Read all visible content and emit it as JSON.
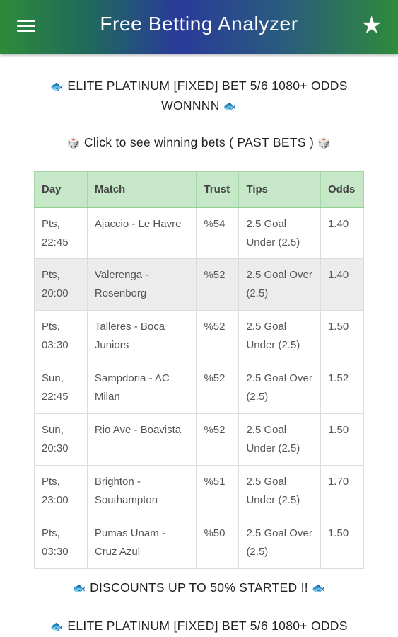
{
  "appbar": {
    "title": "Free Betting Analyzer",
    "menu_icon": "hamburger-menu-icon",
    "star_icon": "star-icon",
    "star_glyph": "★"
  },
  "promos": {
    "elite_top": "ELITE PLATINUM [FIXED] BET 5/6 1080+ ODDS WONNNN",
    "winning_bets": "Click to see winning bets ( PAST BETS )",
    "discounts": "DISCOUNTS UP TO 50% STARTED !!",
    "elite_bottom": "ELITE PLATINUM [FIXED] BET 5/6 1080+ ODDS",
    "fish_glyph": "🐟",
    "dice_glyph": "🎲"
  },
  "table": {
    "headers": {
      "day": "Day",
      "match": "Match",
      "trust": "Trust",
      "tips": "Tips",
      "odds": "Odds"
    },
    "rows": [
      {
        "day": "Pts, 22:45",
        "match": "Ajaccio - Le Havre",
        "trust": "%54",
        "tips": "2.5 Goal Under (2.5)",
        "odds": "1.40"
      },
      {
        "day": "Pts, 20:00",
        "match": "Valerenga - Rosenborg",
        "trust": "%52",
        "tips": "2.5 Goal Over (2.5)",
        "odds": "1.40"
      },
      {
        "day": "Pts, 03:30",
        "match": "Talleres - Boca Juniors",
        "trust": "%52",
        "tips": "2.5 Goal Under (2.5)",
        "odds": "1.50"
      },
      {
        "day": "Sun, 22:45",
        "match": "Sampdoria - AC Milan",
        "trust": "%52",
        "tips": "2.5 Goal Over (2.5)",
        "odds": "1.52"
      },
      {
        "day": "Sun, 20:30",
        "match": "Rio Ave - Boavista",
        "trust": "%52",
        "tips": "2.5 Goal Under (2.5)",
        "odds": "1.50"
      },
      {
        "day": "Pts, 23:00",
        "match": "Brighton - Southampton",
        "trust": "%51",
        "tips": "2.5 Goal Under (2.5)",
        "odds": "1.70"
      },
      {
        "day": "Pts, 03:30",
        "match": "Pumas Unam - Cruz Azul",
        "trust": "%50",
        "tips": "2.5 Goal Over (2.5)",
        "odds": "1.50"
      }
    ]
  },
  "colors": {
    "appbar_green": "#2e8b3a",
    "appbar_blue": "#2a3a9a",
    "header_row": "#c7e8c8",
    "shaded_row": "#ececec"
  }
}
